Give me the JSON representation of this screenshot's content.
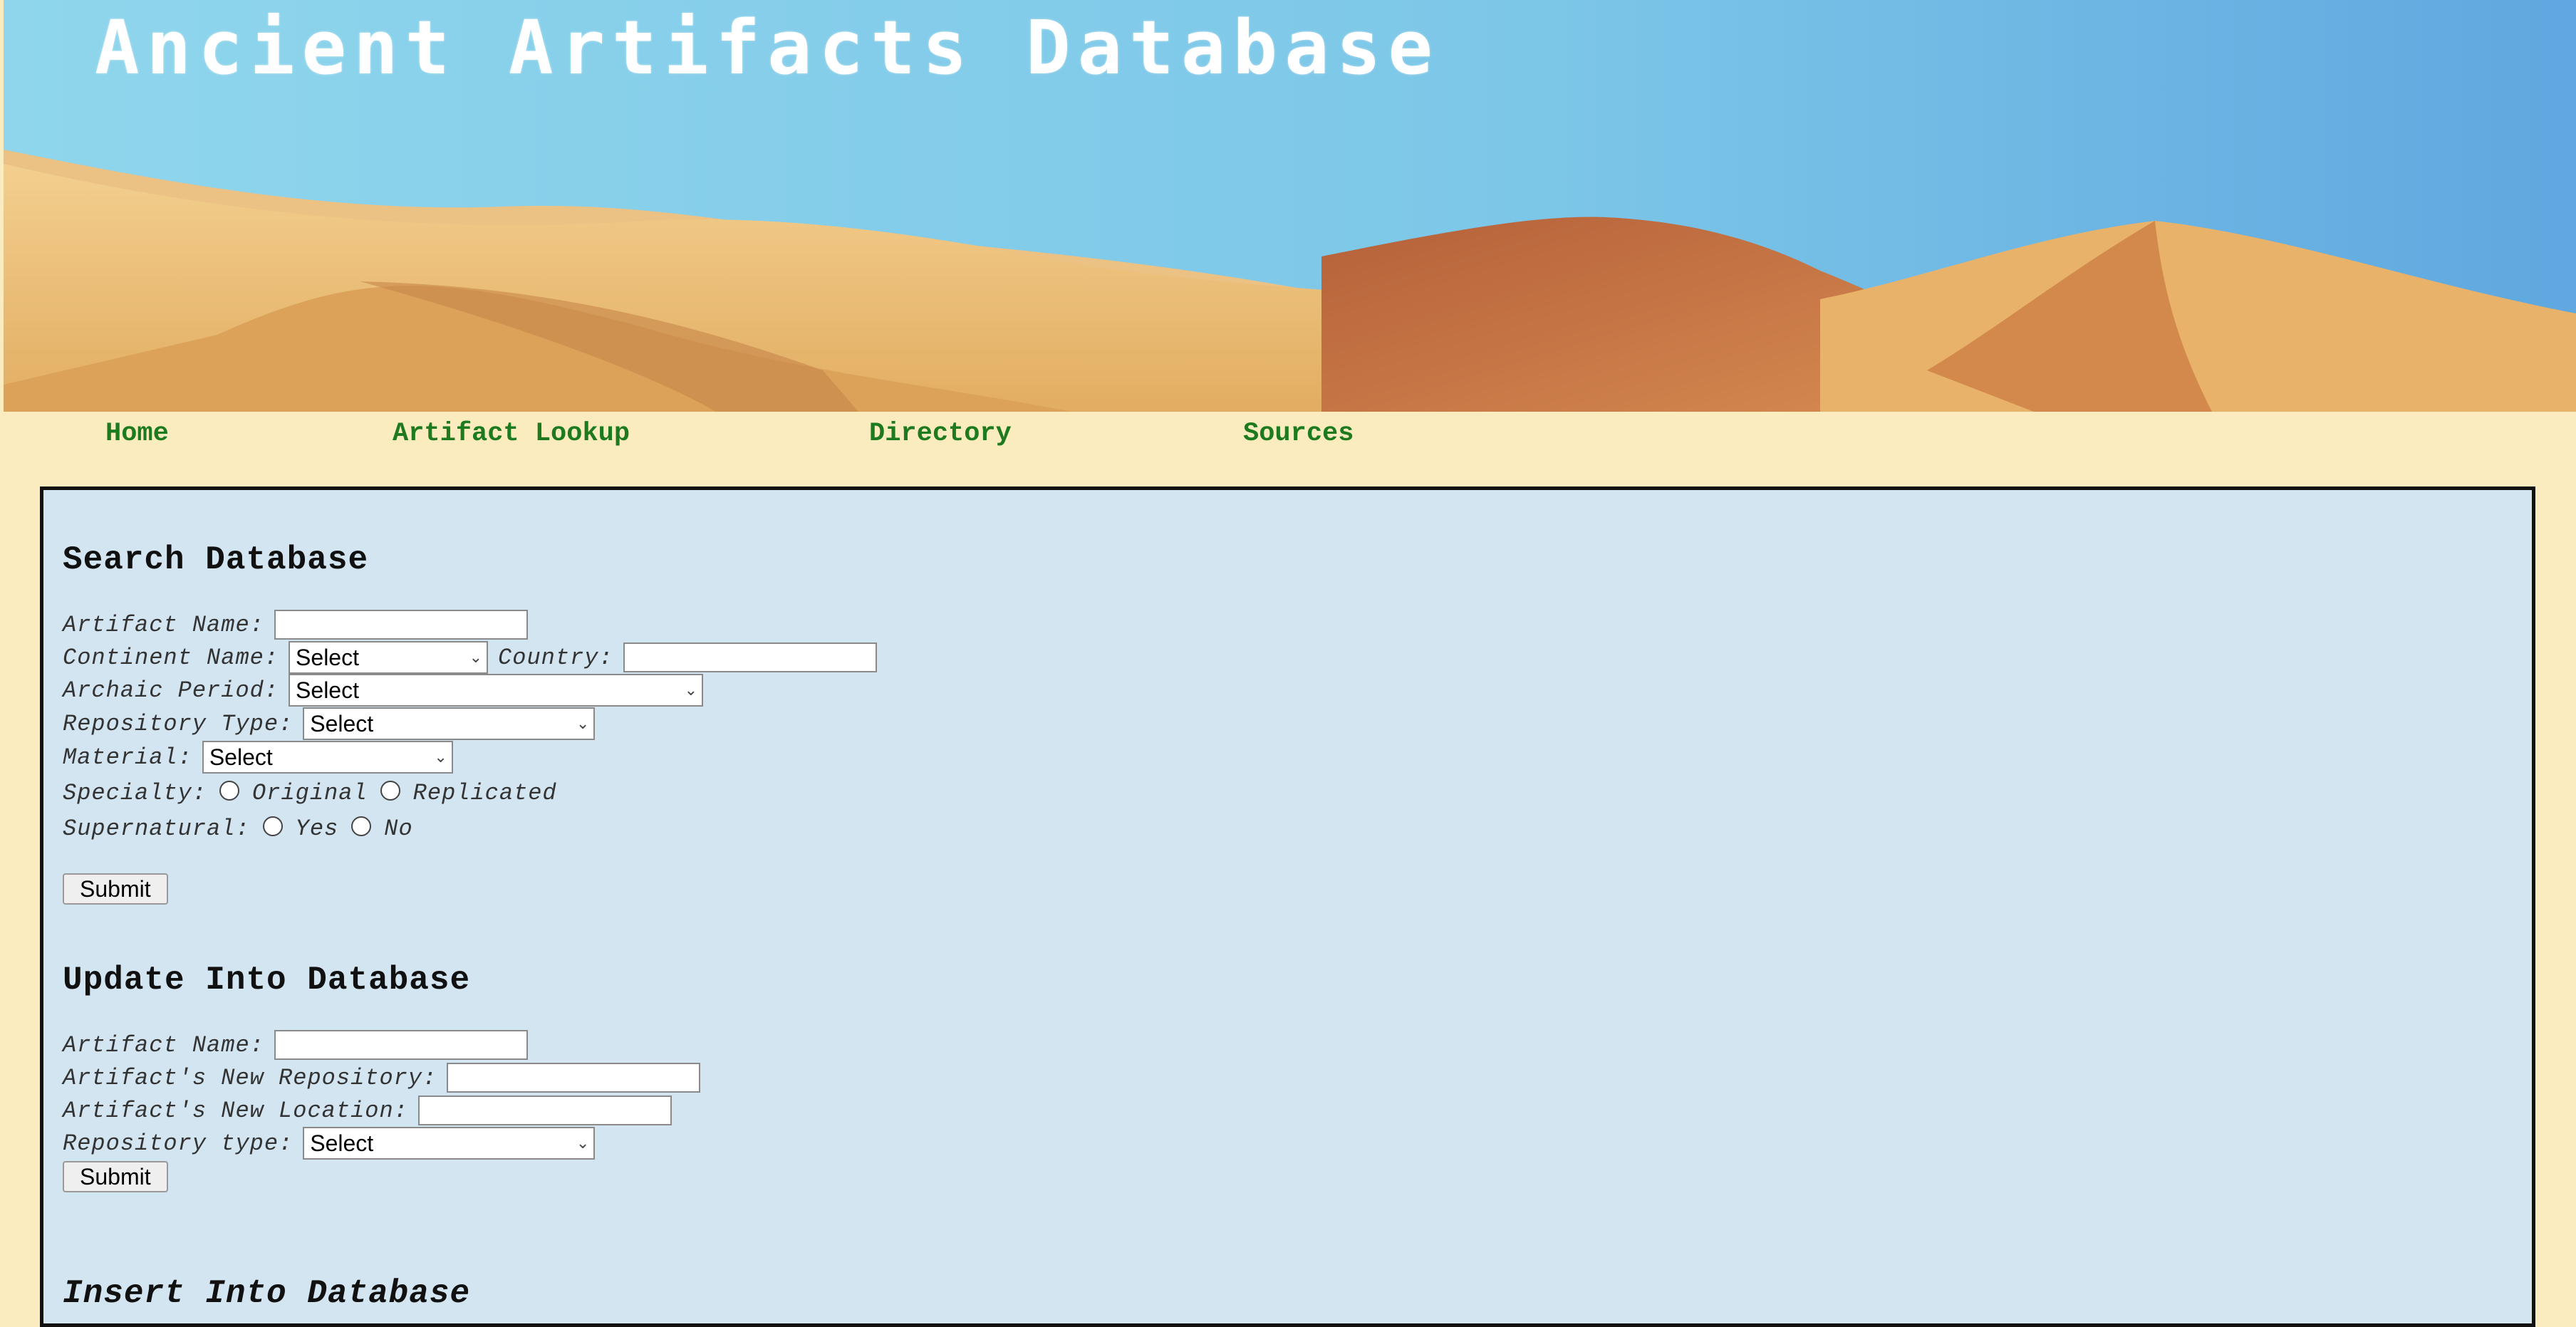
{
  "header": {
    "title": "Ancient Artifacts Database"
  },
  "nav": {
    "items": [
      "Home",
      "Artifact Lookup",
      "Directory",
      "Sources"
    ]
  },
  "colors": {
    "background": "#faecbf",
    "panel": "#d3e5f1",
    "nav_link": "#1e7a1e",
    "border": "#111111"
  },
  "search": {
    "title": "Search Database",
    "artifact_name_label": "Artifact Name:",
    "continent_label": "Continent Name:",
    "continent_value": "Select",
    "country_label": "Country:",
    "period_label": "Archaic Period:",
    "period_value": "Select",
    "repo_type_label": "Repository Type:",
    "repo_type_value": "Select",
    "material_label": "Material:",
    "material_value": "Select",
    "specialty_label": "Specialty:",
    "specialty_original": "Original",
    "specialty_replicated": "Replicated",
    "supernatural_label": "Supernatural:",
    "supernatural_yes": "Yes",
    "supernatural_no": "No",
    "submit_label": "Submit"
  },
  "update": {
    "title": "Update Into Database",
    "artifact_name_label": "Artifact Name:",
    "new_repo_label": "Artifact's New Repository:",
    "new_location_label": "Artifact's New Location:",
    "repo_type_label": "Repository type:",
    "repo_type_value": "Select",
    "submit_label": "Submit"
  },
  "insert": {
    "title": "Insert Into Database"
  }
}
